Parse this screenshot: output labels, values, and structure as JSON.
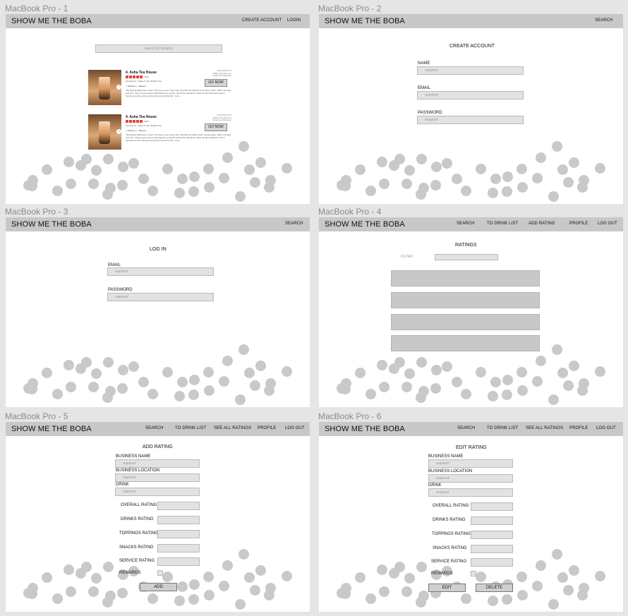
{
  "brand": "SHOW ME THE BOBA",
  "frames": [
    {
      "label": "MacBook Pro - 1",
      "nav": [
        "CREATE ACCOUNT",
        "LOGIN"
      ]
    },
    {
      "label": "MacBook Pro - 2",
      "nav": [
        "SEARCH"
      ]
    },
    {
      "label": "MacBook Pro - 3",
      "nav": [
        "SEARCH"
      ]
    },
    {
      "label": "MacBook Pro - 4",
      "nav": [
        "SEARCH",
        "TO DRINK LIST",
        "ADD RATING",
        "PROFILE",
        "LOG OUT"
      ]
    },
    {
      "label": "MacBook Pro - 5",
      "nav": [
        "SEARCH",
        "TO DRINK LIST",
        "SEE ALL RATINGS",
        "PROFILE",
        "LOG OUT"
      ]
    },
    {
      "label": "MacBook Pro - 6",
      "nav": [
        "SEARCH",
        "TO DRINK LIST",
        "SEE ALL RATINGS",
        "PROFILE",
        "LOG OUT"
      ]
    }
  ],
  "search": {
    "placeholder": "search by location"
  },
  "results": [
    {
      "name": "4. Asha Tea House",
      "reviews": "1303",
      "categories": "Tea Rooms, Coffee & Tea, Bubble Tea",
      "delivery": "✓ Delivery  ✓ Takeout",
      "snippet": "\"My favorite Boba tea in town! The tea is never fruity and I feel that the drinks aren't overly sweet. Staff is friendly and nice. They've got a good ordering/pick up system during the pandemic. Must try! My husband's and I's favorites are the oolong and jasmine tea with boba.\" more",
      "address": "(415) 549-9773 2086 University Ave Downtown Berkeley",
      "button": "GO NOW"
    },
    {
      "name": "4. Asha Tea House",
      "reviews": "1303",
      "categories": "Tea Rooms, Coffee & Tea, Bubble Tea",
      "delivery": "✓ Delivery  ✓ Takeout",
      "snippet": "\"My favorite Boba tea in town! The tea is never fruity and I feel that the drinks aren't overly sweet. Staff is friendly and nice. They've got a good ordering/pick up system during the pandemic. Must try! My husband's and I's favorites are the oolong and jasmine tea with boba.\" more",
      "address": "(415) 549-9773 2086 University Ave Downtown Berkeley",
      "button": "GO NOW"
    }
  ],
  "create_account": {
    "title": "CREATE ACCOUNT",
    "fields": [
      {
        "label": "NAME",
        "placeholder": "required"
      },
      {
        "label": "EMAIL",
        "placeholder": "required"
      },
      {
        "label": "PASSWORD",
        "placeholder": "required"
      }
    ]
  },
  "login": {
    "title": "LOG IN",
    "fields": [
      {
        "label": "EMAIL",
        "placeholder": "required"
      },
      {
        "label": "PASSWORD",
        "placeholder": "required"
      }
    ]
  },
  "ratings": {
    "title": "RATINGS",
    "filter_label": "FILTER"
  },
  "add_rating": {
    "title": "ADD RATING",
    "text_fields": [
      {
        "label": "BUSINESS NAME",
        "placeholder": "required"
      },
      {
        "label": "BUSINESS LOCATION",
        "placeholder": "required"
      },
      {
        "label": "DRINK",
        "placeholder": "required"
      }
    ],
    "score_fields": [
      "OVERALL RATING",
      "DRINKS RATING",
      "TOPPINGS RATING",
      "SNACKS RATING",
      "SERVICE RATING"
    ],
    "rewards_label": "REWARDS",
    "add_button": "ADD"
  },
  "edit_rating": {
    "title": "EDIT RATING",
    "text_fields": [
      {
        "label": "BUSINESS NAME",
        "placeholder": "required"
      },
      {
        "label": "BUSINESS LOCATION",
        "placeholder": "required"
      },
      {
        "label": "DRINK",
        "placeholder": "required"
      }
    ],
    "score_fields": [
      "OVERALL RATING",
      "DRINKS RATING",
      "TOPPINGS RATING",
      "SNACKS RATING",
      "SERVICE RATING"
    ],
    "rewards_label": "REWARDS",
    "edit_button": "EDIT",
    "delete_button": "DELETE"
  }
}
